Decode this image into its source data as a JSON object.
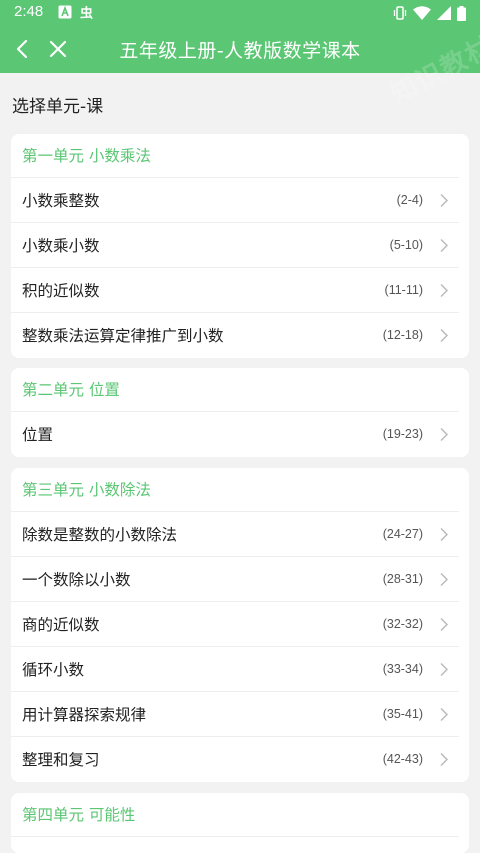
{
  "status_bar": {
    "time": "2:48",
    "left_icons": [
      "a-notification-icon",
      "bug-notification-icon"
    ],
    "right_icons": [
      "vibrate-icon",
      "wifi-icon",
      "signal-icon",
      "battery-icon"
    ]
  },
  "app_bar": {
    "title": "五年级上册-人教版数学课本",
    "watermark": "知识教材"
  },
  "section_heading": "选择单元-课",
  "colors": {
    "accent": "#5bc674",
    "background": "#f2f2f2"
  },
  "units": [
    {
      "title": "第一单元 小数乘法",
      "lessons": [
        {
          "label": "小数乘整数",
          "range": "(2-4)"
        },
        {
          "label": "小数乘小数",
          "range": "(5-10)"
        },
        {
          "label": "积的近似数",
          "range": "(11-11)"
        },
        {
          "label": "整数乘法运算定律推广到小数",
          "range": "(12-18)"
        }
      ]
    },
    {
      "title": "第二单元 位置",
      "lessons": [
        {
          "label": "位置",
          "range": "(19-23)"
        }
      ]
    },
    {
      "title": "第三单元 小数除法",
      "lessons": [
        {
          "label": "除数是整数的小数除法",
          "range": "(24-27)"
        },
        {
          "label": "一个数除以小数",
          "range": "(28-31)"
        },
        {
          "label": "商的近似数",
          "range": "(32-32)"
        },
        {
          "label": "循环小数",
          "range": "(33-34)"
        },
        {
          "label": "用计算器探索规律",
          "range": "(35-41)"
        },
        {
          "label": "整理和复习",
          "range": "(42-43)"
        }
      ]
    },
    {
      "title": "第四单元 可能性",
      "lessons": []
    }
  ]
}
